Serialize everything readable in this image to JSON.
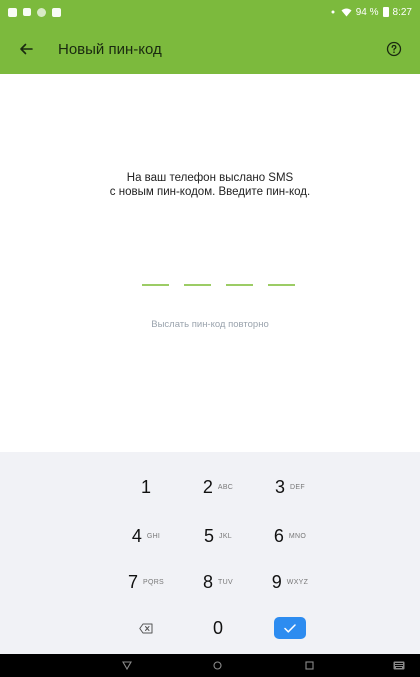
{
  "status_bar": {
    "battery_text": "94 %",
    "time": "8:27"
  },
  "app_bar": {
    "title": "Новый пин-код"
  },
  "content": {
    "instruction_line1": "На ваш телефон выслано SMS",
    "instruction_line2": "с новым пин-кодом. Введите пин-код.",
    "resend_label": "Выслать пин-код повторно",
    "pin_slots": 4
  },
  "keypad": {
    "keys": [
      {
        "digit": "1",
        "letters": ""
      },
      {
        "digit": "2",
        "letters": "ABC"
      },
      {
        "digit": "3",
        "letters": "DEF"
      },
      {
        "digit": "4",
        "letters": "GHI"
      },
      {
        "digit": "5",
        "letters": "JKL"
      },
      {
        "digit": "6",
        "letters": "MNO"
      },
      {
        "digit": "7",
        "letters": "PQRS"
      },
      {
        "digit": "8",
        "letters": "TUV"
      },
      {
        "digit": "9",
        "letters": "WXYZ"
      },
      {
        "digit": "0",
        "letters": ""
      }
    ],
    "backspace_icon": "backspace-icon",
    "confirm_icon": "checkmark-icon"
  },
  "colors": {
    "primary_green": "#7cba3d",
    "pin_slot": "#9ccc65",
    "confirm_blue": "#2d8cf0",
    "keypad_bg": "#f1f2f6"
  }
}
